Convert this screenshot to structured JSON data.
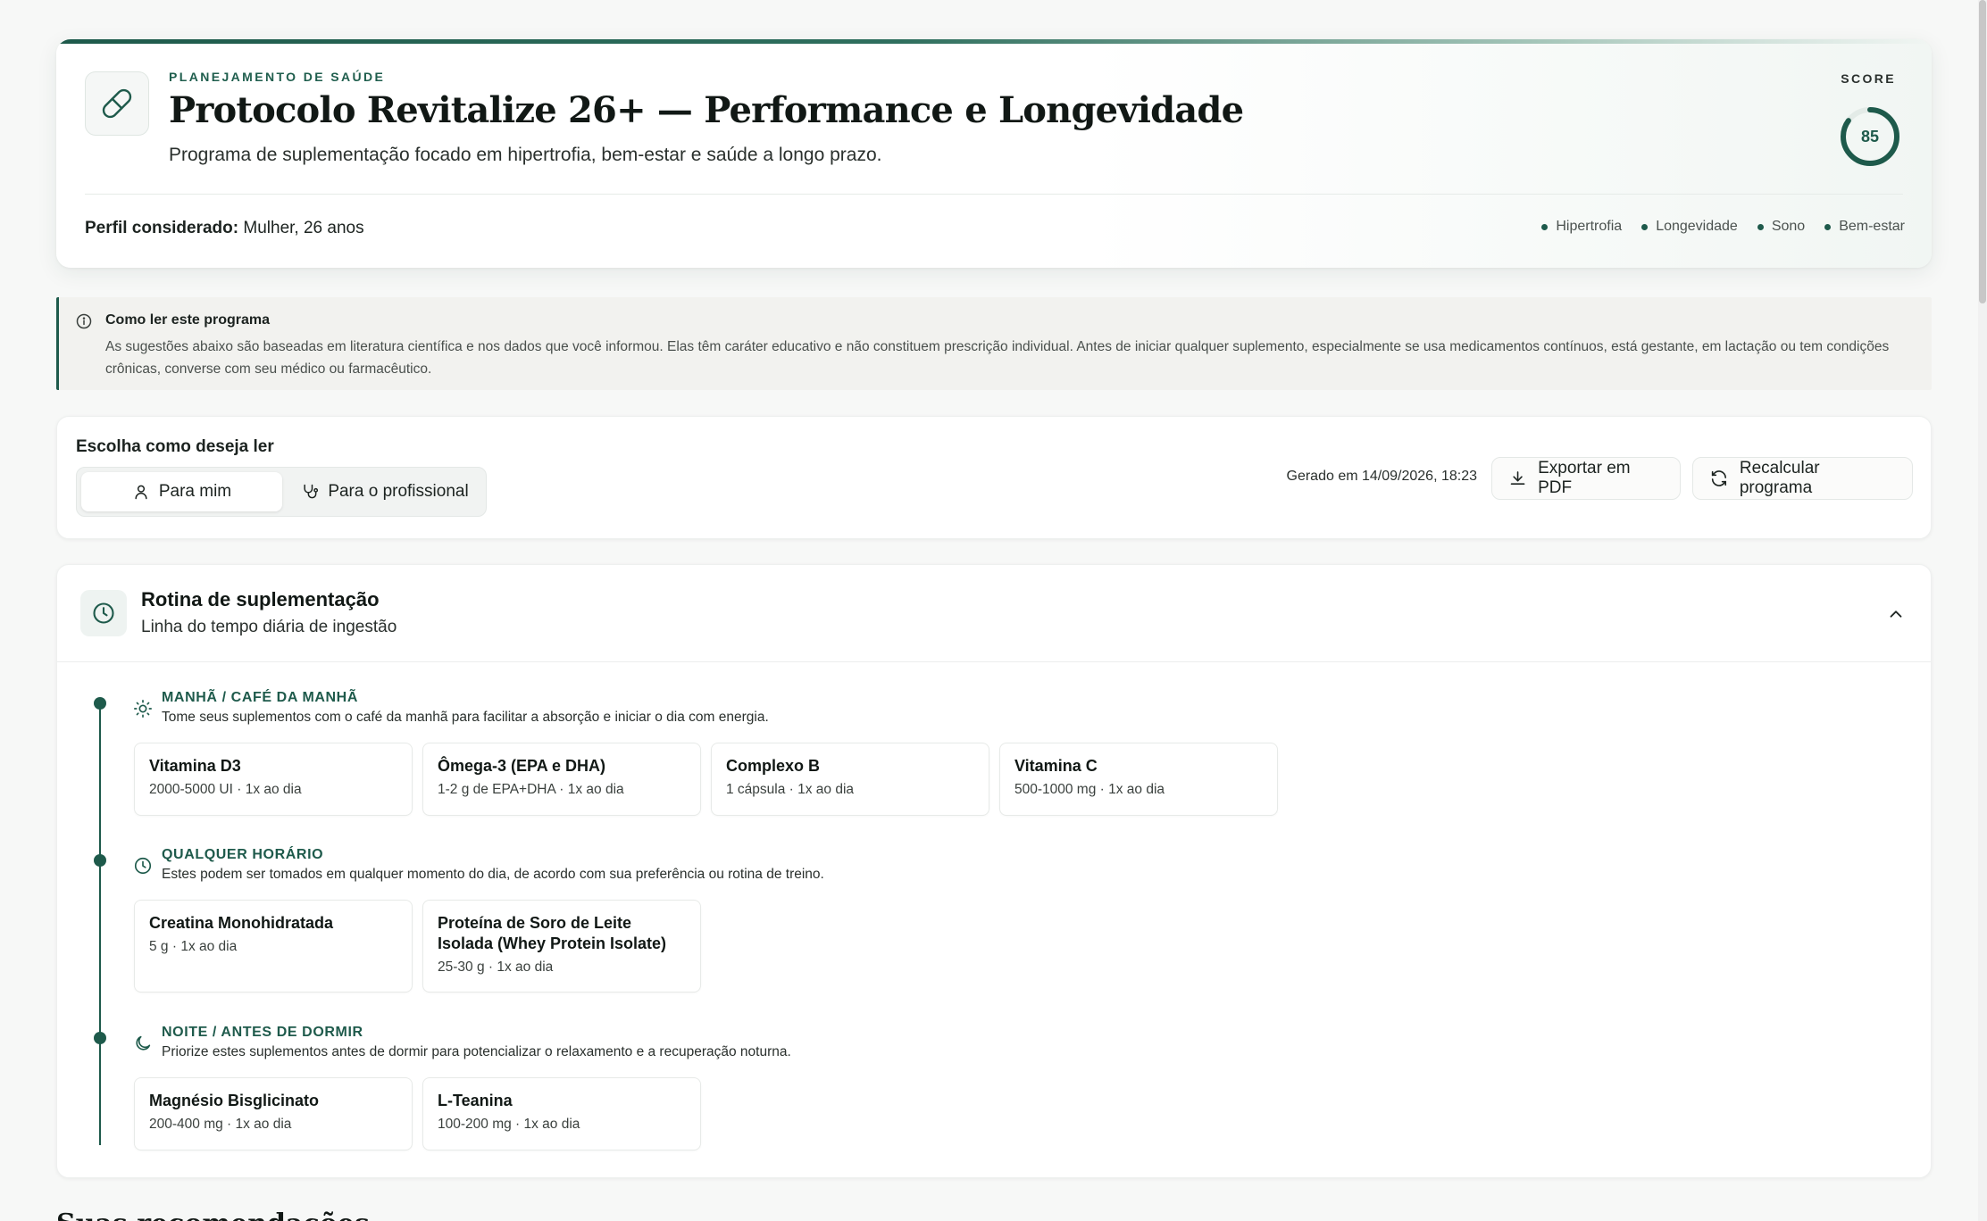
{
  "header": {
    "eyebrow": "PLANEJAMENTO DE SAÚDE",
    "title": "Protocolo Revitalize 26+ — Performance e Longevidade",
    "subtitle": "Programa de suplementação focado em hipertrofia, bem-estar e saúde a longo prazo.",
    "profile_label": "Perfil considerado:",
    "profile_value": "Mulher, 26 anos",
    "score_label": "SCORE",
    "score_value": "85",
    "tags": [
      "Hipertrofia",
      "Longevidade",
      "Sono",
      "Bem-estar"
    ],
    "icon": "pill-icon"
  },
  "info": {
    "title": "Como ler este programa",
    "body": "As sugestões abaixo são baseadas em literatura científica e nos dados que você informou. Elas têm caráter educativo e não constituem prescrição individual. Antes de iniciar qualquer suplemento, especialmente se usa medicamentos contínuos, está gestante, em lactação ou tem condições crônicas, converse com seu médico ou farmacêutico."
  },
  "mode": {
    "label": "Escolha como deseja ler",
    "options": [
      "Para mim",
      "Para o profissional"
    ],
    "selected": "Para mim",
    "generated": "Gerado em 14/09/2026, 18:23",
    "export_label": "Exportar em PDF",
    "recalc_label": "Recalcular programa"
  },
  "routine": {
    "title": "Rotina de suplementação",
    "subtitle": "Linha do tempo diária de ingestão",
    "groups": [
      {
        "title": "MANHÃ / CAFÉ DA MANHÃ",
        "icon": "sun-icon",
        "desc": "Tome seus suplementos com o café da manhã para facilitar a absorção e iniciar o dia com energia.",
        "items": [
          {
            "name": "Vitamina D3",
            "dose": "2000-5000 UI · 1x ao dia"
          },
          {
            "name": "Ômega-3 (EPA e DHA)",
            "dose": "1-2 g de EPA+DHA · 1x ao dia"
          },
          {
            "name": "Complexo B",
            "dose": "1 cápsula · 1x ao dia"
          },
          {
            "name": "Vitamina C",
            "dose": "500-1000 mg · 1x ao dia"
          }
        ]
      },
      {
        "title": "QUALQUER HORÁRIO",
        "icon": "clock-icon",
        "desc": "Estes podem ser tomados em qualquer momento do dia, de acordo com sua preferência ou rotina de treino.",
        "items": [
          {
            "name": "Creatina Monohidratada",
            "dose": "5 g · 1x ao dia"
          },
          {
            "name": "Proteína de Soro de Leite Isolada (Whey Protein Isolate)",
            "dose": "25-30 g · 1x ao dia"
          }
        ]
      },
      {
        "title": "NOITE / ANTES DE DORMIR",
        "icon": "moon-icon",
        "desc": "Priorize estes suplementos antes de dormir para potencializar o relaxamento e a recuperação noturna.",
        "items": [
          {
            "name": "Magnésio Bisglicinato",
            "dose": "200-400 mg · 1x ao dia"
          },
          {
            "name": "L-Teanina",
            "dose": "100-200 mg · 1x ao dia"
          }
        ]
      }
    ]
  },
  "next_section_title": "Suas recomendações",
  "colors": {
    "accent": "#1e5a4b",
    "background": "#f7f8f7",
    "info_bg": "#f2f2ef"
  }
}
